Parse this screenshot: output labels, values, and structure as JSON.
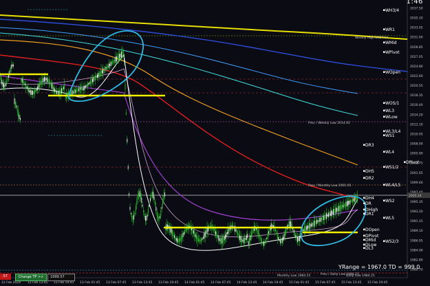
{
  "clock": "00:01:46",
  "yrange_text": "YRange = 1967.0   TD = 999.0",
  "buttons": {
    "change_tp": "Change TP >>",
    "tp_value": "1999.57",
    "left_value": ".57"
  },
  "levels": [
    {
      "label": "WH3/4",
      "color": "#ffffff"
    },
    {
      "label": "WR1",
      "color": "#ffffff"
    },
    {
      "label": "WMid",
      "color": "#ffffff"
    },
    {
      "label": "WPivot",
      "color": "#ffffff"
    },
    {
      "label": "WOpen",
      "color": "#ffffff"
    },
    {
      "label": "WOS/1",
      "color": "#ffffff"
    },
    {
      "label": "WL3",
      "color": "#ffffff"
    },
    {
      "label": "WLow",
      "color": "#ffffff"
    },
    {
      "label": "WL3/L4",
      "color": "#ffffff"
    },
    {
      "label": "WS1",
      "color": "#ffffff"
    },
    {
      "label": "DR3",
      "color": "#ffffff"
    },
    {
      "label": "WL4",
      "color": "#ffffff"
    },
    {
      "label": "DPivot",
      "color": "#ffffff"
    },
    {
      "label": "DH5",
      "color": "#ffffff"
    },
    {
      "label": "WS1/2",
      "color": "#ffffff"
    },
    {
      "label": "DR2",
      "color": "#ffffff"
    },
    {
      "label": "WL4/L5",
      "color": "#ffffff"
    },
    {
      "label": "DH4",
      "color": "#ffffff"
    },
    {
      "label": "DR",
      "color": "#ffffff"
    },
    {
      "label": "WS2",
      "color": "#ffffff"
    },
    {
      "label": "DHigh",
      "color": "#ffffff"
    },
    {
      "label": "DR1",
      "color": "#ffffff"
    },
    {
      "label": "WL5",
      "color": "#ffffff"
    },
    {
      "label": "DOpen",
      "color": "#ffffff"
    },
    {
      "label": "DPivot",
      "color": "#ffffff"
    },
    {
      "label": "DMid",
      "color": "#ffffff"
    },
    {
      "label": "WS2/3",
      "color": "#ffffff"
    },
    {
      "label": "DLow",
      "color": "#ffffff"
    },
    {
      "label": "DL3",
      "color": "#ffffff"
    }
  ],
  "annotations": [
    {
      "text": "Weekly High 2027.54",
      "color": "#c8c800"
    },
    {
      "text": "Prev / Weekly Low 2014.92",
      "color": "#d060d0"
    },
    {
      "text": "Prev / Monthly Low 2001.91",
      "color": "#e0a030"
    },
    {
      "text": "Prev / Daily Low 1984.25",
      "color": "#40c0ff"
    },
    {
      "text": "Daily Low 1984.25",
      "color": "#ff4040"
    },
    {
      "text": "Monthly Low 1984.25",
      "color": "#ff4040"
    }
  ],
  "price_axis": [
    "2037.50",
    "2035.10",
    "2033.05",
    "2031.00",
    "2028.85",
    "2027.05",
    "2024.80",
    "2022.60",
    "2020.55",
    "2018.35",
    "2016.40",
    "2014.20",
    "2012.10",
    "2010.05",
    "2008.00",
    "2005.90",
    "2003.75",
    "2001.65",
    "1999.60",
    "1997.40",
    "1995.35",
    "1993.20",
    "1991.15",
    "1989.10",
    "1986.95",
    "1984.90",
    "1982.80",
    "1980.70"
  ],
  "current_price": "2000.24",
  "time_axis": [
    "12 Feb 2024",
    "12 Feb 13:45",
    "12 Feb 19:45",
    "13 Feb 01:45",
    "13 Feb 07:45",
    "13 Feb 13:45",
    "13 Feb 19:45",
    "14 Feb 01:45",
    "14 Feb 07:45",
    "14 Feb 13:45",
    "14 Feb 19:45",
    "15 Feb 01:45",
    "15 Feb 07:45",
    "15 Feb 13:45",
    "15 Feb 19:45"
  ]
}
